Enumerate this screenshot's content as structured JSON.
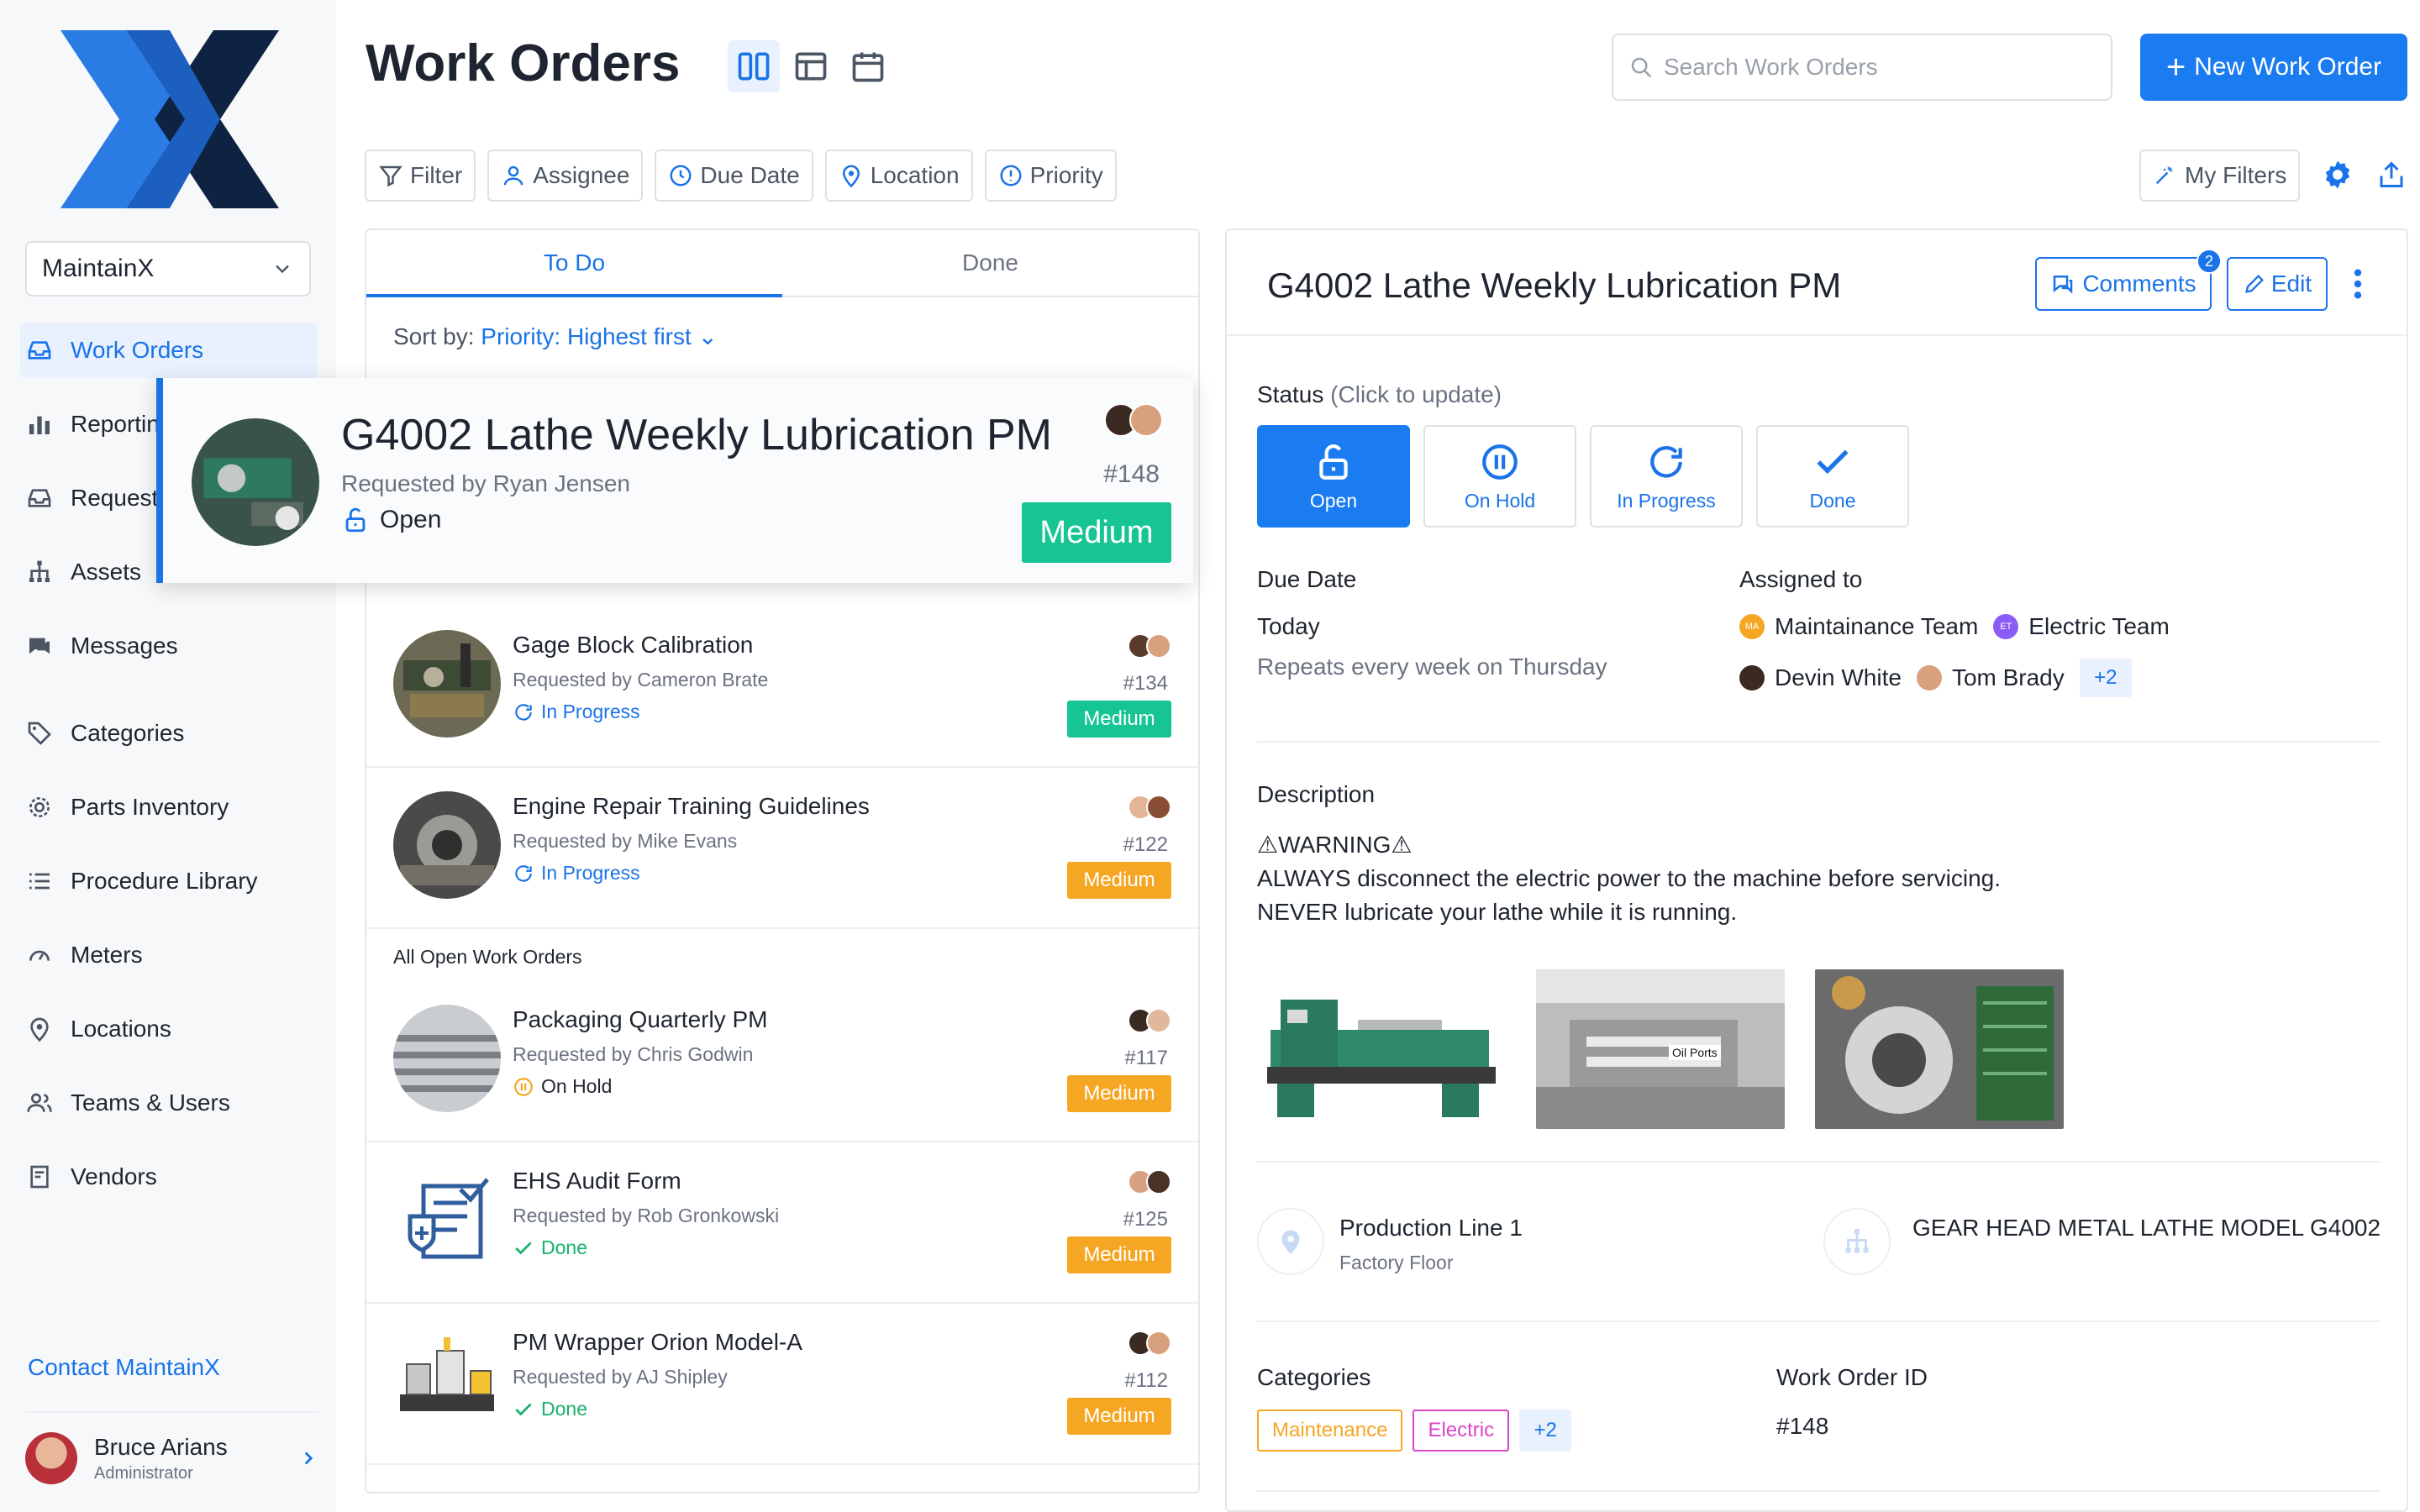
{
  "app": {
    "org": "MaintainX",
    "contact": "Contact MaintainX"
  },
  "colors": {
    "accent": "#1a7cf0",
    "medium_green": "#17c494",
    "medium_orange": "#f5a623",
    "done_green": "#17b26a",
    "onhold_orange": "#f5a623"
  },
  "sidebar": {
    "items": [
      {
        "label": "Work Orders",
        "icon": "inbox-icon"
      },
      {
        "label": "Reporting",
        "icon": "bar-chart-icon"
      },
      {
        "label": "Requests",
        "icon": "inbox-tray-icon"
      },
      {
        "label": "Assets",
        "icon": "hierarchy-icon"
      },
      {
        "label": "Messages",
        "icon": "chat-icon"
      },
      {
        "label": "Categories",
        "icon": "tag-icon"
      },
      {
        "label": "Parts Inventory",
        "icon": "cog-icon"
      },
      {
        "label": "Procedure Library",
        "icon": "list-icon"
      },
      {
        "label": "Meters",
        "icon": "gauge-icon"
      },
      {
        "label": "Locations",
        "icon": "pin-icon"
      },
      {
        "label": "Teams & Users",
        "icon": "users-icon"
      },
      {
        "label": "Vendors",
        "icon": "document-icon"
      }
    ],
    "user": {
      "name": "Bruce Arians",
      "role": "Administrator"
    }
  },
  "header": {
    "title": "Work Orders",
    "search_placeholder": "Search Work Orders",
    "new_button": "New Work Order",
    "filters": [
      "Filter",
      "Assignee",
      "Due Date",
      "Location",
      "Priority"
    ],
    "my_filters": "My Filters"
  },
  "list": {
    "tabs": [
      "To Do",
      "Done"
    ],
    "sort_label": "Sort by:",
    "sort_value": "Priority: Highest first",
    "featured": {
      "title": "G4002 Lathe Weekly Lubrication PM",
      "requested": "Requested by Ryan Jensen",
      "status": "Open",
      "num": "#148",
      "priority": "Medium"
    },
    "items": [
      {
        "title": "Gage Block Calibration",
        "requested": "Requested by Cameron Brate",
        "status": "In Progress",
        "num": "#134",
        "priority": "Medium"
      },
      {
        "title": "Engine Repair Training Guidelines",
        "requested": "Requested by Mike Evans",
        "status": "In Progress",
        "num": "#122",
        "priority": "Medium"
      }
    ],
    "section": "All Open Work Orders",
    "open_items": [
      {
        "title": "Packaging Quarterly PM",
        "requested": "Requested by Chris Godwin",
        "status": "On Hold",
        "num": "#117",
        "priority": "Medium"
      },
      {
        "title": "EHS Audit Form",
        "requested": "Requested by Rob Gronkowski",
        "status": "Done",
        "num": "#125",
        "priority": "Medium"
      },
      {
        "title": "PM Wrapper Orion Model-A",
        "requested": "Requested by AJ Shipley",
        "status": "Done",
        "num": "#112",
        "priority": "Medium"
      }
    ]
  },
  "detail": {
    "title": "G4002 Lathe Weekly Lubrication PM",
    "comments": "Comments",
    "comments_count": "2",
    "edit": "Edit",
    "status_label": "Status",
    "status_hint": "(Click to update)",
    "statuses": [
      "Open",
      "On Hold",
      "In Progress",
      "Done"
    ],
    "due_label": "Due Date",
    "due_value": "Today",
    "repeat": "Repeats every week on Thursday",
    "assigned_label": "Assigned to",
    "teams": [
      {
        "name": "Maintainance Team",
        "initials": "MA"
      },
      {
        "name": "Electric Team",
        "initials": "ET"
      }
    ],
    "people": [
      "Devin White",
      "Tom Brady"
    ],
    "more_assignees": "+2",
    "desc_label": "Description",
    "desc_lines": [
      "⚠WARNING⚠",
      "ALWAYS disconnect the electric power to the machine before servicing.",
      "NEVER lubricate your lathe while it is running."
    ],
    "image_caption": "Oil Ports",
    "location": "Production Line 1",
    "location_sub": "Factory Floor",
    "asset": "GEAR HEAD METAL LATHE MODEL G4002",
    "categories_label": "Categories",
    "categories": [
      "Maintenance",
      "Electric"
    ],
    "more_categories": "+2",
    "woid_label": "Work Order ID",
    "woid": "#148"
  }
}
